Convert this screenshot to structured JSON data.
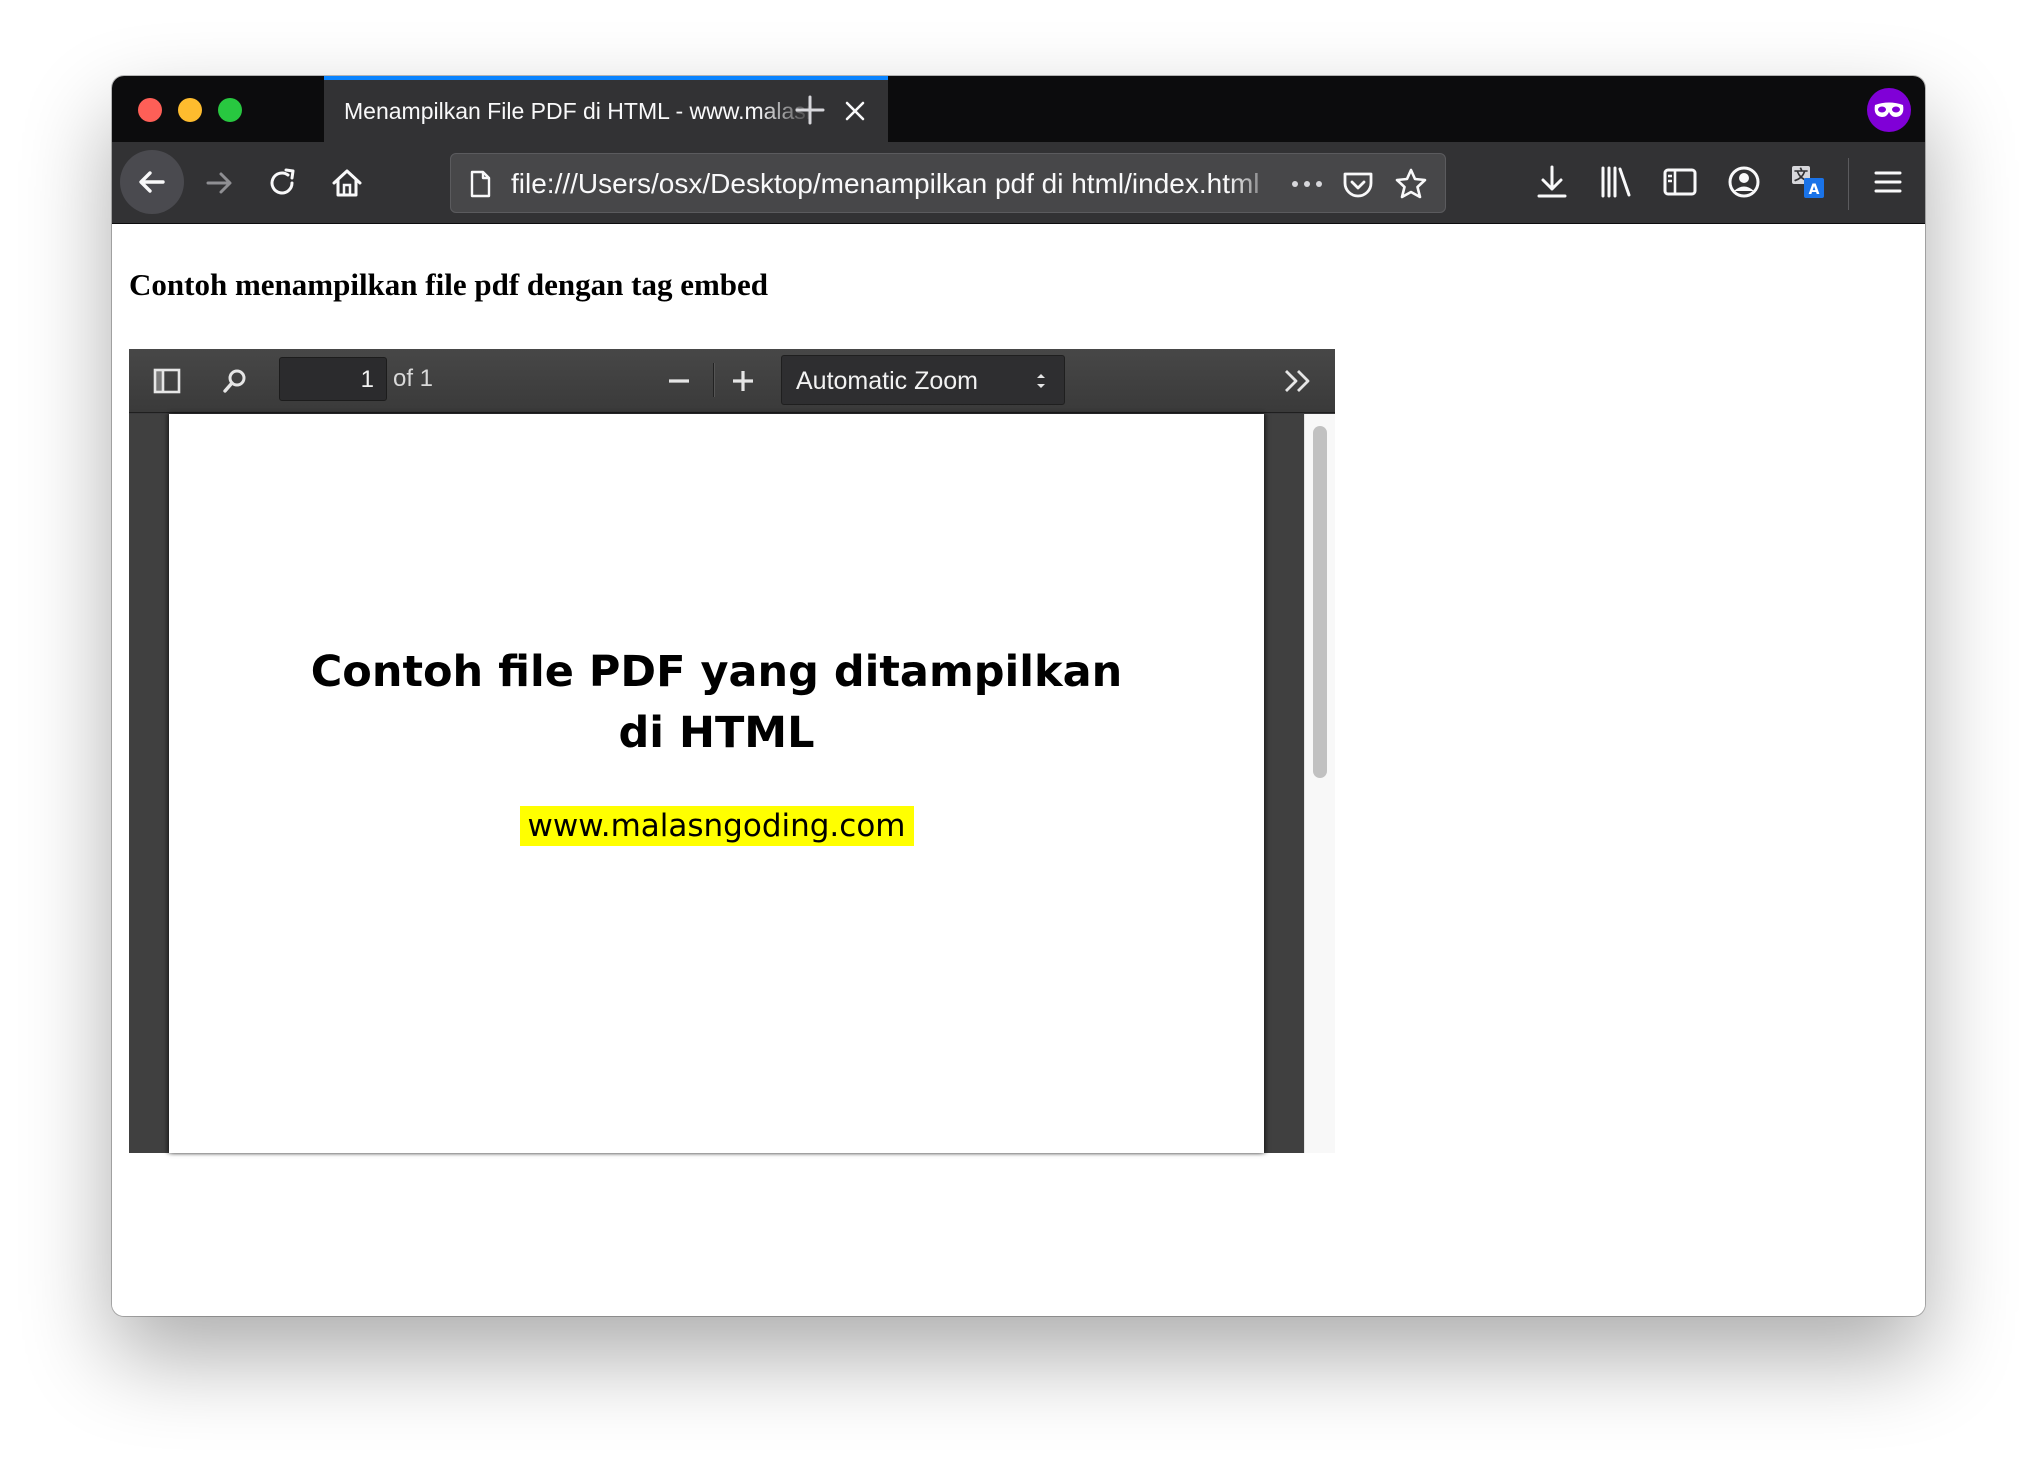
{
  "browser": {
    "tab": {
      "title": "Menampilkan File PDF di HTML - www.malasngoding.com"
    },
    "url": "file:///Users/osx/Desktop/menampilkan pdf di html/index.html",
    "icons": {
      "back": "back-arrow-icon",
      "forward": "forward-arrow-icon",
      "reload": "reload-icon",
      "home": "home-icon",
      "page": "page-icon",
      "more": "more-dots-icon",
      "pocket": "pocket-icon",
      "bookmark": "star-icon",
      "downloads": "download-icon",
      "library": "library-icon",
      "sidebar": "sidebar-icon",
      "account": "account-icon",
      "translate": "translate-icon",
      "menu": "hamburger-menu-icon",
      "private": "private-browsing-mask-icon"
    },
    "colors": {
      "accent": "#0a84ff",
      "private": "#8000d7"
    }
  },
  "page": {
    "heading": "Contoh menampilkan file pdf dengan tag embed"
  },
  "pdf_viewer": {
    "page_number": "1",
    "page_count": "of 1",
    "zoom": "Automatic Zoom",
    "document": {
      "title_line1": "Contoh file PDF yang ditampilkan",
      "title_line2": "di HTML",
      "link": "www.malasngoding.com",
      "link_highlight": "#ffff00"
    }
  }
}
